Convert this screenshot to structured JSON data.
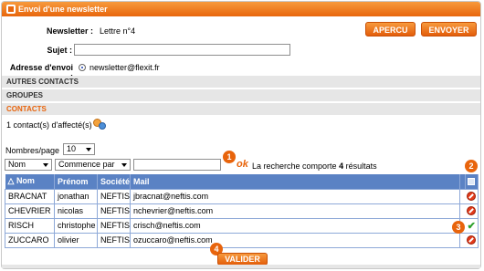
{
  "window": {
    "title": "Envoi d'une newsletter"
  },
  "form": {
    "newsletter_label": "Newsletter :",
    "newsletter_value": "Lettre n°4",
    "sujet_label": "Sujet :",
    "sujet_value": "",
    "adresse_label": "Adresse d'envoi :",
    "adresse_value": "newsletter@flexit.fr"
  },
  "buttons": {
    "apercu": "APERCU",
    "envoyer": "ENVOYER",
    "valider": "VALIDER"
  },
  "sections": {
    "autres": "AUTRES CONTACTS",
    "groupes": "GROUPES",
    "contacts": "CONTACTS"
  },
  "contacts_info": "1 contact(s) d'affecté(s)",
  "pagination": {
    "label": "Nombres/page",
    "value": "10"
  },
  "filters": {
    "field": "Nom",
    "mode": "Commence par",
    "query": ""
  },
  "search": {
    "ok": "ok",
    "result_prefix": "La recherche comporte ",
    "result_count": "4",
    "result_suffix": " résultats"
  },
  "badges": {
    "b1": "1",
    "b2": "2",
    "b3": "3",
    "b4": "4"
  },
  "table": {
    "headers": {
      "nom": "Nom",
      "prenom": "Prénom",
      "societe": "Société",
      "mail": "Mail"
    },
    "sort_glyph": "△",
    "rows": [
      {
        "nom": "BRACNAT",
        "prenom": "jonathan",
        "societe": "NEFTIS",
        "mail": "jbracnat@neftis.com",
        "status": "no"
      },
      {
        "nom": "CHEVRIER",
        "prenom": "nicolas",
        "societe": "NEFTIS",
        "mail": "nchevrier@neftis.com",
        "status": "no"
      },
      {
        "nom": "RISCH",
        "prenom": "christophe",
        "societe": "NEFTIS",
        "mail": "crisch@neftis.com",
        "status": "yes"
      },
      {
        "nom": "ZUCCARO",
        "prenom": "olivier",
        "societe": "NEFTIS",
        "mail": "ozuccaro@neftis.com",
        "status": "no"
      }
    ]
  },
  "colors": {
    "accent": "#e8640c",
    "header_blue": "#5a82c4"
  }
}
